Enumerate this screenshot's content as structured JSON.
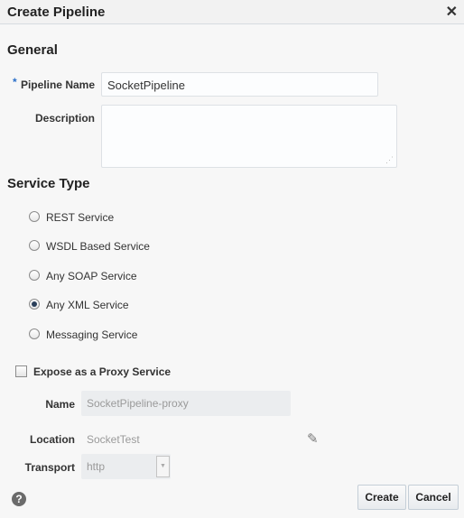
{
  "dialog": {
    "title": "Create Pipeline"
  },
  "general": {
    "heading": "General",
    "required_marker": "*",
    "pipeline_name_label": "Pipeline Name",
    "pipeline_name_value": "SocketPipeline",
    "description_label": "Description",
    "description_value": ""
  },
  "service_type": {
    "heading": "Service Type",
    "options": [
      {
        "label": "REST Service",
        "selected": false
      },
      {
        "label": "WSDL Based Service",
        "selected": false
      },
      {
        "label": "Any SOAP Service",
        "selected": false
      },
      {
        "label": "Any XML Service",
        "selected": true
      },
      {
        "label": "Messaging Service",
        "selected": false
      }
    ]
  },
  "proxy": {
    "expose_label": "Expose as a Proxy Service",
    "checked": false,
    "name_label": "Name",
    "name_value": "SocketPipeline-proxy",
    "location_label": "Location",
    "location_value": "SocketTest",
    "transport_label": "Transport",
    "transport_value": "http"
  },
  "footer": {
    "create_label": "Create",
    "cancel_label": "Cancel"
  }
}
